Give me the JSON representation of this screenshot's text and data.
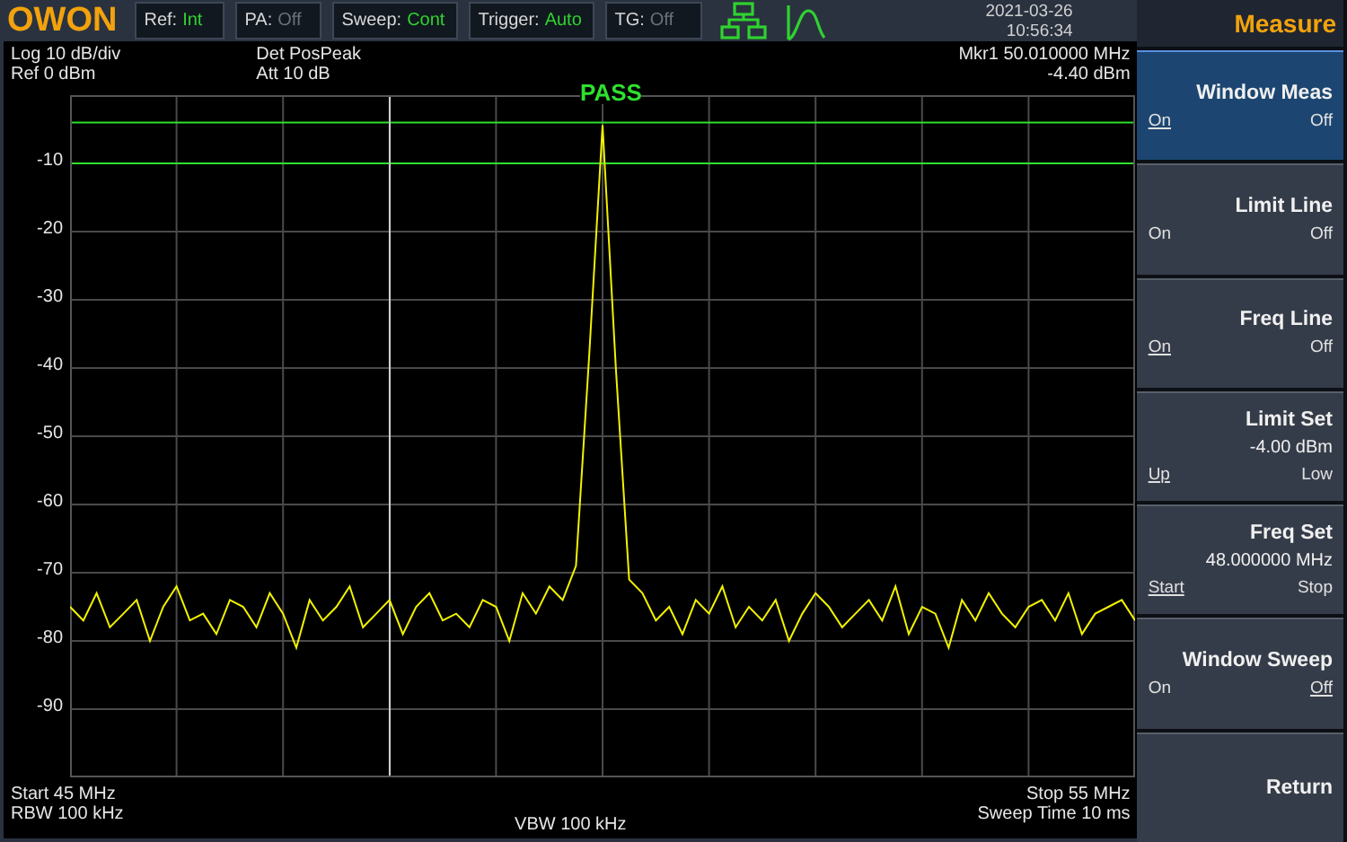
{
  "top_bar": {
    "logo": "OWON",
    "status": [
      {
        "label": "Ref:",
        "value": "Int",
        "active": true
      },
      {
        "label": "PA:",
        "value": "Off",
        "active": false
      },
      {
        "label": "Sweep:",
        "value": "Cont",
        "active": true
      },
      {
        "label": "Trigger:",
        "value": "Auto",
        "active": true
      },
      {
        "label": "TG:",
        "value": "Off",
        "active": false
      }
    ],
    "date": "2021-03-26",
    "time": "10:56:34"
  },
  "screen": {
    "header_left": [
      "Log 10 dB/div",
      "Ref 0 dBm"
    ],
    "header_mid": [
      "Det PosPeak",
      "Att 10 dB"
    ],
    "marker": [
      "Mkr1  50.010000 MHz",
      "-4.40 dBm"
    ],
    "verdict": "PASS",
    "chart_data": {
      "type": "line",
      "grid": true,
      "ref_lines": [
        {
          "axis": "y",
          "value": -4,
          "color": "#2fe02f"
        },
        {
          "axis": "y",
          "value": -10,
          "color": "#2fe02f"
        }
      ],
      "categories": [
        null,
        null,
        null,
        null,
        null,
        null,
        null,
        null,
        null,
        null,
        null,
        null,
        null,
        null,
        null,
        null,
        null,
        null,
        null,
        null,
        null,
        null,
        null,
        null,
        null,
        null,
        null,
        null,
        null,
        null,
        null,
        null,
        null,
        null,
        null,
        null,
        null,
        null,
        null,
        null,
        null,
        null,
        null,
        null,
        null,
        null,
        null,
        null,
        null,
        null,
        null,
        null,
        null,
        null,
        null,
        null,
        null,
        null,
        null,
        null,
        null,
        null,
        null,
        null,
        null,
        null,
        null,
        null,
        null,
        null,
        null,
        null,
        null,
        null,
        null,
        null,
        null,
        null,
        null,
        null,
        null
      ],
      "ylim": [
        -100,
        0
      ],
      "yticks": [
        {
          "value": -10,
          "label": "-10"
        },
        {
          "value": -20,
          "label": "-20"
        },
        {
          "value": -30,
          "label": "-30"
        },
        {
          "value": -40,
          "label": "-40"
        },
        {
          "value": -50,
          "label": "-50"
        },
        {
          "value": -60,
          "label": "-60"
        },
        {
          "value": -70,
          "label": "-70"
        },
        {
          "value": -80,
          "label": "-80"
        },
        {
          "value": -90,
          "label": "-90"
        }
      ],
      "series": [
        {
          "color": "#f2f200",
          "values": [
            -75,
            -77,
            -73,
            -78,
            -76,
            -74,
            -80,
            -75,
            -72,
            -77,
            -76,
            -79,
            -74,
            -75,
            -78,
            -73,
            -76,
            -81,
            -74,
            -77,
            -75,
            -72,
            -78,
            -76,
            -74,
            -79,
            -75,
            -73,
            -77,
            -76,
            -78,
            -74,
            -75,
            -80,
            -73,
            -76,
            -72,
            -74,
            -69,
            -38,
            -4.4,
            -40,
            -71,
            -73,
            -77,
            -75,
            -79,
            -74,
            -76,
            -72,
            -78,
            -75,
            -77,
            -74,
            -80,
            -76,
            -73,
            -75,
            -78,
            -76,
            -74,
            -77,
            -72,
            -79,
            -75,
            -76,
            -81,
            -74,
            -77,
            -73,
            -76,
            -78,
            -75,
            -74,
            -77,
            -73,
            -79,
            -76,
            -75,
            -74,
            -77
          ]
        }
      ]
    },
    "footer_left": [
      "Start 45 MHz",
      "RBW 100 kHz"
    ],
    "footer_mid": "VBW 100 kHz",
    "footer_right": [
      "Stop 55 MHz",
      "Sweep Time 10 ms"
    ]
  },
  "menu": {
    "title": "Measure",
    "softkeys": [
      {
        "kind": "toggle",
        "title": "Window Meas",
        "highlighted": true,
        "options": [
          {
            "label": "On",
            "selected": true
          },
          {
            "label": "Off",
            "selected": false
          }
        ]
      },
      {
        "kind": "toggle",
        "title": "Limit Line",
        "highlighted": false,
        "options": [
          {
            "label": "On",
            "selected": false
          },
          {
            "label": "Off",
            "selected": false
          }
        ]
      },
      {
        "kind": "toggle",
        "title": "Freq Line",
        "highlighted": false,
        "options": [
          {
            "label": "On",
            "selected": true
          },
          {
            "label": "Off",
            "selected": false
          }
        ]
      },
      {
        "kind": "toggle",
        "title": "Limit Set",
        "value": "-4.00 dBm",
        "highlighted": false,
        "options": [
          {
            "label": "Up",
            "selected": true
          },
          {
            "label": "Low",
            "selected": false
          }
        ]
      },
      {
        "kind": "toggle",
        "title": "Freq Set",
        "value": "48.000000 MHz",
        "highlighted": false,
        "options": [
          {
            "label": "Start",
            "selected": true
          },
          {
            "label": "Stop",
            "selected": false
          }
        ]
      },
      {
        "kind": "toggle",
        "title": "Window Sweep",
        "highlighted": false,
        "options": [
          {
            "label": "On",
            "selected": false
          },
          {
            "label": "Off",
            "selected": true
          }
        ]
      },
      {
        "kind": "action",
        "title": "Return",
        "highlighted": false
      }
    ]
  }
}
